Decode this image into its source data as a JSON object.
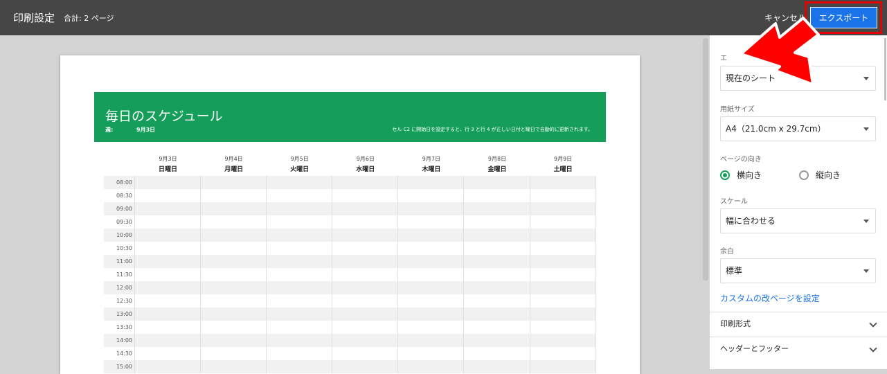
{
  "header": {
    "title": "印刷設定",
    "page_count": "合計: 2 ページ",
    "cancel_label": "キャンセル",
    "export_label": "エクスポート"
  },
  "sheet": {
    "title": "毎日のスケジュール",
    "week_label": "週:",
    "week_value": "9月3日",
    "note": "セル C2 に開始日を設定すると、行 3 と行 4 が正しい日付と曜日で自動的に更新されます。",
    "days": [
      {
        "date": "9月3日",
        "weekday": "日曜日"
      },
      {
        "date": "9月4日",
        "weekday": "月曜日"
      },
      {
        "date": "9月5日",
        "weekday": "火曜日"
      },
      {
        "date": "9月6日",
        "weekday": "水曜日"
      },
      {
        "date": "9月7日",
        "weekday": "木曜日"
      },
      {
        "date": "9月8日",
        "weekday": "金曜日"
      },
      {
        "date": "9月9日",
        "weekday": "土曜日"
      }
    ],
    "times": [
      "08:00",
      "08:30",
      "09:00",
      "09:30",
      "10:00",
      "10:30",
      "11:00",
      "11:30",
      "12:00",
      "12:30",
      "13:00",
      "13:30",
      "14:00",
      "14:30",
      "15:00"
    ]
  },
  "panel": {
    "export_label": "エ",
    "export_value": "現在のシート",
    "paper_label": "用紙サイズ",
    "paper_value": "A4（21.0cm x 29.7cm）",
    "orientation_label": "ページの向き",
    "orientation_landscape": "横向き",
    "orientation_portrait": "縦向き",
    "scale_label": "スケール",
    "scale_value": "幅に合わせる",
    "margin_label": "余白",
    "margin_value": "標準",
    "custom_break_link": "カスタムの改ページを設定",
    "section_format": "印刷形式",
    "section_header_footer": "ヘッダーとフッター"
  },
  "colors": {
    "topbar": "#464646",
    "accent_green": "#149e5a",
    "button_blue": "#1a73e8",
    "highlight_red": "#e60000"
  }
}
